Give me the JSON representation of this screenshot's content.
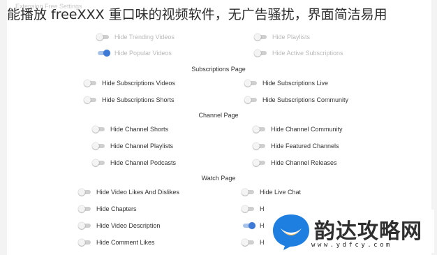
{
  "overlay_title": "能播放 freeXXX 重口味的视频软件，无广告骚扰，界面简洁易用",
  "settings_title": "Extension Free Settings",
  "sections": {
    "subscriptions": "Subscriptions Page",
    "channel": "Channel Page",
    "watch": "Watch Page"
  },
  "toggles": {
    "trending_videos": "Hide Trending Videos",
    "playlists": "Hide Playlists",
    "popular_videos": "Hide Popular Videos",
    "active_subscriptions": "Hide Active Subscriptions",
    "subscriptions_videos": "Hide Subscriptions Videos",
    "subscriptions_live": "Hide Subscriptions Live",
    "subscriptions_shorts": "Hide Subscriptions Shorts",
    "subscriptions_community": "Hide Subscriptions Community",
    "channel_shorts": "Hide Channel Shorts",
    "channel_community": "Hide Channel Community",
    "channel_playlists": "Hide Channel Playlists",
    "featured_channels": "Hide Featured Channels",
    "channel_podcasts": "Hide Channel Podcasts",
    "channel_releases": "Hide Channel Releases",
    "video_likes": "Hide Video Likes And Dislikes",
    "live_chat": "Hide Live Chat",
    "chapters": "Hide Chapters",
    "video_description": "Hide Video Description",
    "comment_likes": "Hide Comment Likes",
    "partial_h": "H"
  },
  "toggle_states": {
    "popular_videos": true,
    "partial_description_row": true,
    "others": false
  },
  "watermark": {
    "name": "韵达攻略网",
    "url": "www.ydfcy.com"
  },
  "colors": {
    "toggle_on": "#3d7ad8",
    "toggle_off_track": "#cfcfcf",
    "logo_bubble": "#1f7fe0",
    "logo_accent": "#f5a623"
  }
}
